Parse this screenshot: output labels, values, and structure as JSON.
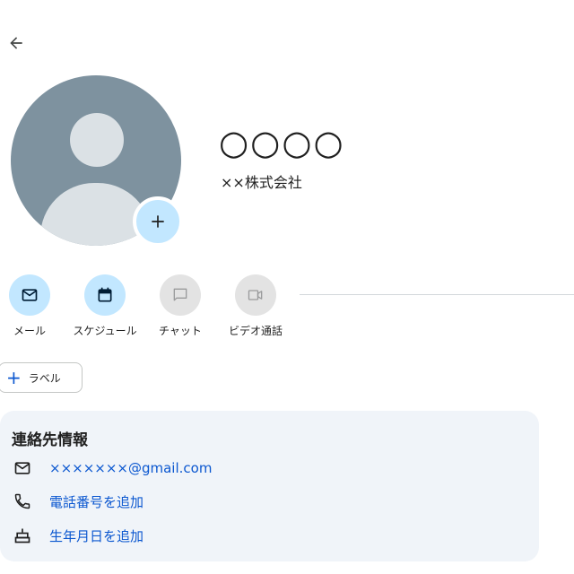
{
  "header": {
    "back_icon": "arrow-back-icon"
  },
  "contact": {
    "name": "○○○○",
    "company": "××株式会社",
    "avatar_icon": "person-placeholder-icon",
    "add_photo_icon": "plus-icon"
  },
  "actions": [
    {
      "label": "メール",
      "icon": "mail-icon",
      "enabled": true
    },
    {
      "label": "スケジュール",
      "icon": "calendar-icon",
      "enabled": true
    },
    {
      "label": "チャット",
      "icon": "chat-icon",
      "enabled": false
    },
    {
      "label": "ビデオ通話",
      "icon": "video-icon",
      "enabled": false
    }
  ],
  "label_button": {
    "icon": "plus-icon",
    "text": "ラベル"
  },
  "contact_info": {
    "title": "連絡先情報",
    "email": "×××××××@gmail.com",
    "add_phone": "電話番号を追加",
    "add_birthday": "生年月日を追加",
    "email_icon": "mail-icon",
    "phone_icon": "phone-icon",
    "birthday_icon": "cake-icon"
  },
  "colors": {
    "accent": "#0b57d0",
    "action_active_bg": "#c2e7ff",
    "action_disabled_bg": "#e3e3e3",
    "card_bg": "#f0f4f9",
    "avatar_bg": "#7e929f"
  }
}
